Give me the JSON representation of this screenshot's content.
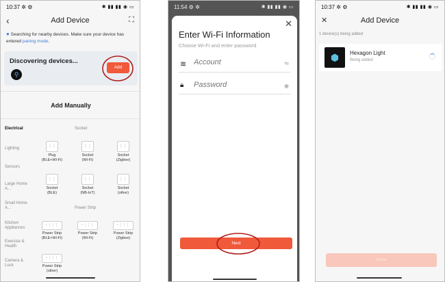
{
  "phone1": {
    "status_time": "10:37",
    "status_icons": "✲ ⚙",
    "status_right": "✱ ▮▮ ▮▮ ◉ ▭",
    "title": "Add Device",
    "searching_text": "Searching for nearby devices. Make sure your device has entered ",
    "pairing_link": "pairing mode",
    "pairing_period": ".",
    "discovering": "Discovering devices...",
    "add_button": "Add",
    "add_manually": "Add Manually",
    "categories": [
      "Electrical",
      "Lighting",
      "Sensors",
      "Large Home A...",
      "Small Home A...",
      "Kitchen Appliances",
      "Exercise & Health",
      "Camera & Lock"
    ],
    "section_socket": "Socket",
    "section_power_strip": "Power Strip",
    "devices": [
      {
        "label": "Plug\n(BLE+Wi-Fi)"
      },
      {
        "label": "Socket\n(Wi-Fi)"
      },
      {
        "label": "Socket\n(Zigbee)"
      },
      {
        "label": "Socket\n(BLE)"
      },
      {
        "label": "Socket\n(NB-IoT)"
      },
      {
        "label": "Socket\n(other)"
      },
      {
        "label": "Power Strip\n(BLE+Wi-Fi)"
      },
      {
        "label": "Power Strip\n(Wi-Fi)"
      },
      {
        "label": "Power Strip\n(Zigbee)"
      },
      {
        "label": "Power Strip\n(other)"
      }
    ]
  },
  "phone2": {
    "status_time": "11:54",
    "status_icons": "⚙ ✲",
    "status_right": "✱ ▮▮ ▮▮ ◉ ▭",
    "title": "Enter Wi-Fi Information",
    "subtitle": "Choose Wi-Fi and enter password",
    "account_placeholder": "Account",
    "password_placeholder": "Password",
    "next_button": "Next"
  },
  "phone3": {
    "status_time": "10:37",
    "status_icons": "✲ ⚙",
    "status_right": "✱ ▮▮ ▮▮ ◉ ▭",
    "title": "Add Device",
    "count_text": "1 device(s) being added",
    "device_name": "Hexagon Light",
    "device_status": "Being added",
    "done_button": "Done"
  },
  "colors": {
    "accent": "#f0593a",
    "accent_light": "#f9c7bb",
    "highlight_ring": "#b0201c",
    "link": "#3d7fd8"
  }
}
